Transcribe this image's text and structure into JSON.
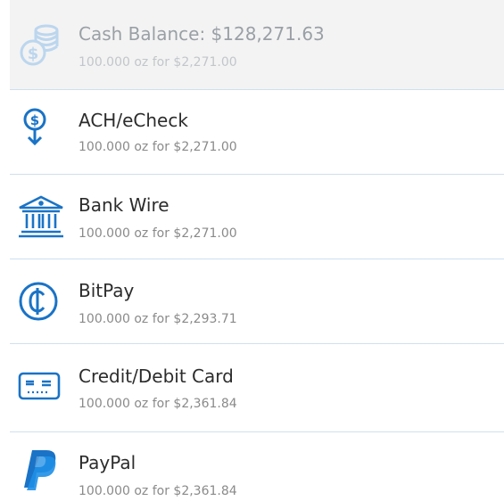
{
  "payment_methods": [
    {
      "name": "Cash Balance: $128,271.63",
      "detail": "100.000 oz for $2,271.00",
      "icon": "coins-icon",
      "enabled": false
    },
    {
      "name": "ACH/eCheck",
      "detail": "100.000 oz for $2,271.00",
      "icon": "dollar-down-icon",
      "enabled": true
    },
    {
      "name": "Bank Wire",
      "detail": "100.000 oz for $2,271.00",
      "icon": "bank-icon",
      "enabled": true
    },
    {
      "name": "BitPay",
      "detail": "100.000 oz for $2,293.71",
      "icon": "bitcoin-cent-icon",
      "enabled": true
    },
    {
      "name": "Credit/Debit Card",
      "detail": "100.000 oz for $2,361.84",
      "icon": "credit-card-icon",
      "enabled": true
    },
    {
      "name": "PayPal",
      "detail": "100.000 oz for $2,361.84",
      "icon": "paypal-icon",
      "enabled": true
    }
  ],
  "colors": {
    "icon_blue": "#1a73c6",
    "icon_disabled": "#bcd6ee",
    "divider": "#cfe0ef",
    "disabled_bg": "#f3f3f3"
  }
}
